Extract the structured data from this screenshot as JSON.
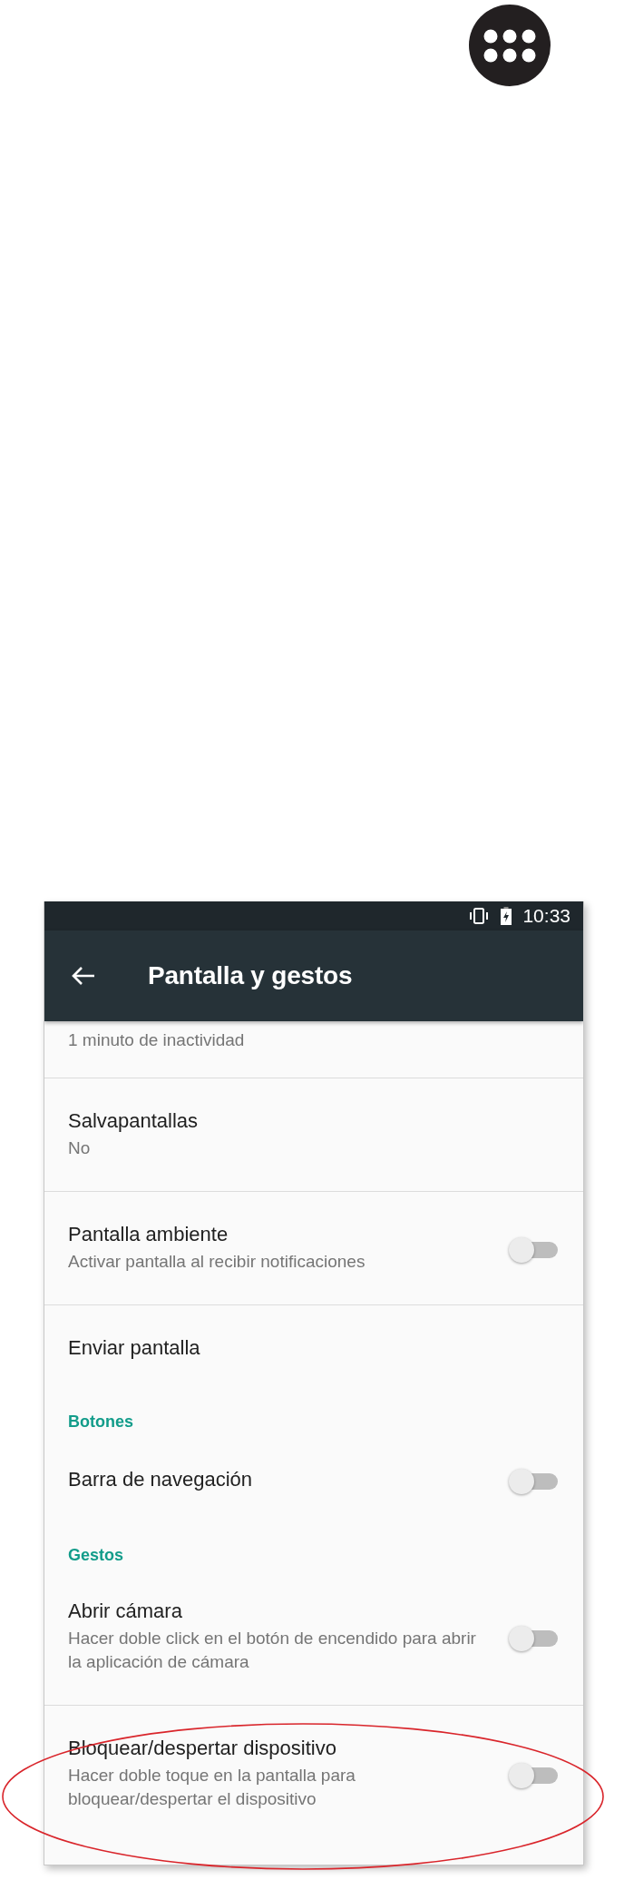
{
  "status_bar": {
    "time": "10:33"
  },
  "toolbar": {
    "title": "Pantalla y gestos"
  },
  "settings": [
    {
      "kind": "item",
      "summary": "1 minuto de inactividad"
    },
    {
      "kind": "item",
      "title": "Salvapantallas",
      "summary": "No"
    },
    {
      "kind": "item",
      "title": "Pantalla ambiente",
      "summary": "Activar pantalla al recibir notificaciones",
      "toggle": {
        "on": false
      }
    },
    {
      "kind": "item",
      "title": "Enviar pantalla"
    },
    {
      "kind": "header",
      "title": "Botones"
    },
    {
      "kind": "item",
      "title": "Barra de navegación",
      "toggle": {
        "on": false
      }
    },
    {
      "kind": "header",
      "title": "Gestos"
    },
    {
      "kind": "item",
      "title": "Abrir cámara",
      "summary": "Hacer doble click en el botón de encendido para abrir la aplicación de cámara",
      "toggle": {
        "on": false
      }
    },
    {
      "kind": "item",
      "title": "Bloquear/despertar dispositivo",
      "summary": "Hacer doble toque en la pantalla para bloquear/despertar el dispositivo",
      "toggle": {
        "on": false
      }
    }
  ]
}
